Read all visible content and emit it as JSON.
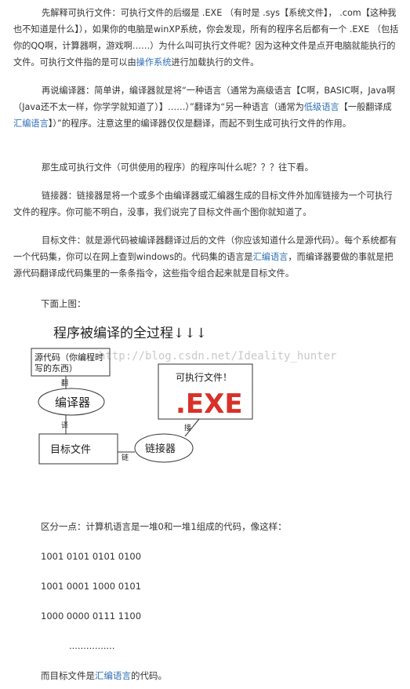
{
  "paragraphs": [
    {
      "segments": [
        {
          "text": "先解释可执行文件：可执行文件的后缀是 .EXE （有时是 .sys【系统文件】， .com【这种我也不知道是什么】），如果你的电脑是winXP系统，你会发现，所有的程序名后都有一个 .EXE （包括你的QQ啊，计算器啊，游戏啊……）为什么叫可执行文件呢？因为这种文件是点开电脑就能执行的文件。可执行文件指的是可以由",
          "link": false
        },
        {
          "text": "操作系统",
          "link": true
        },
        {
          "text": "进行加载执行的文件。",
          "link": false
        }
      ]
    },
    {
      "segments": [
        {
          "text": "再说编译器：简单讲，编译器就是将“一种语言（通常为高级语言【C啊，BASIC啊，Java啊（Java还不太一样，你学学就知道了）】……）”翻译为“另一种语言（通常为",
          "link": false
        },
        {
          "text": "低级语言",
          "link": true
        },
        {
          "text": "【一般翻译成",
          "link": false
        },
        {
          "text": "汇编语言",
          "link": true
        },
        {
          "text": "】）”的程序。注意这里的编译器仅仅是翻译，而起不到生成可执行文件的作用。",
          "link": false
        }
      ]
    },
    {
      "segments": [
        {
          "text": "那生成可执行文件（可供使用的程序）的程序叫什么呢？？？往下看。",
          "link": false
        }
      ]
    },
    {
      "segments": [
        {
          "text": "链接器：链接器是将一个或多个由编译器或汇编器生成的目标文件外加库链接为一个可执行文件的程序。你可能不明白，没事，我们说完了目标文件画个图你就知道了。",
          "link": false
        }
      ]
    },
    {
      "segments": [
        {
          "text": "目标文件：就是源代码被编译器翻译过后的文件（你应该知道什么是源代码）。每个系统都有一个代码集，你可以在网上查到windows的。代码集的语言是",
          "link": false
        },
        {
          "text": "汇编语言",
          "link": true
        },
        {
          "text": "，而编译器要做的事就是把源代码翻译成代码集里的一条条指令，这些指令组合起来就是目标文件。",
          "link": false
        }
      ]
    }
  ],
  "below_pic": "下面上图：",
  "diagram": {
    "title": "程序被编译的全过程↓↓↓",
    "watermark": "http://blog.csdn.net/Ideality_hunter",
    "source_box": "源代码（你编程时写的东西）",
    "source_line1": "源代码（你编程时",
    "source_line2": "写的东西）",
    "compiler": "编译器",
    "target_box": "目标文件",
    "linker": "链接器",
    "exe_box_label": "可执行文件！",
    "exe_text": ".EXE",
    "arrow_fan": "翻",
    "arrow_yi": "译",
    "arrow_lian": "链",
    "arrow_jie": "接"
  },
  "distinguish": "区分一点：计算机语言是一堆0和一堆1组成的代码，像这样：",
  "codes": [
    "1001 0101 0101 0100",
    "1001 0001 1000 0101",
    "1000 0000 0111 1100"
  ],
  "dots": "................",
  "final": {
    "before": "而目标文件是",
    "link": "汇编语言",
    "after": "的代码。"
  },
  "colors": {
    "link": "#2f6fb5",
    "text": "#333333",
    "exe_red": "#d9302a"
  }
}
